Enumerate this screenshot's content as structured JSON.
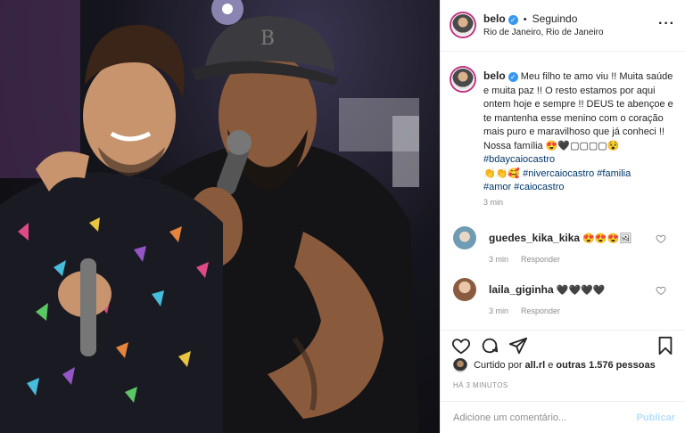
{
  "post": {
    "author": "belo",
    "follow_status": "Seguindo",
    "location": "Rio de Janeiro, Rio de Janeiro",
    "caption_user": "belo",
    "caption_main": "Meu filho te amo viu !! Muita saúde e muita paz !! O resto estamos por aqui ontem hoje e sempre !! DEUS te abençoe e te mantenha esse menino com o coração mais puro e maravilhoso que já conheci !! Nossa família 😍🖤▢▢▢▢😵 ",
    "tags_line1": "#bdaycaiocastro",
    "emoji_line": "👏👏🥰",
    "tags_line2": "#nivercaiocastro #familia",
    "tags_line3": "#amor #caiocastro",
    "caption_time": "3 min"
  },
  "comments": [
    {
      "user": "guedes_kika_kika",
      "text": "😍😍😍🖼",
      "time": "3 min",
      "reply": "Responder",
      "avatar_color": "#6f9bb3"
    },
    {
      "user": "laila_giginha",
      "text": "🖤🖤🖤🖤",
      "time": "3 min",
      "reply": "Responder",
      "avatar_color": "#c79b7c"
    }
  ],
  "likes": {
    "prefix": "Curtido por",
    "user": "all.rl",
    "middle": "e",
    "others": "outras 1.576 pessoas"
  },
  "time_ago": "HÁ 3 MINUTOS",
  "composer": {
    "placeholder": "Adicione um comentário...",
    "submit": "Publicar"
  },
  "icons": [
    "verified-icon",
    "more-options-icon",
    "heart-icon",
    "comment-icon",
    "share-icon",
    "bookmark-icon"
  ],
  "colors": {
    "link": "#00376b",
    "muted": "#8e8e8e",
    "verified": "#3897f0",
    "publish": "#b2dffc"
  }
}
